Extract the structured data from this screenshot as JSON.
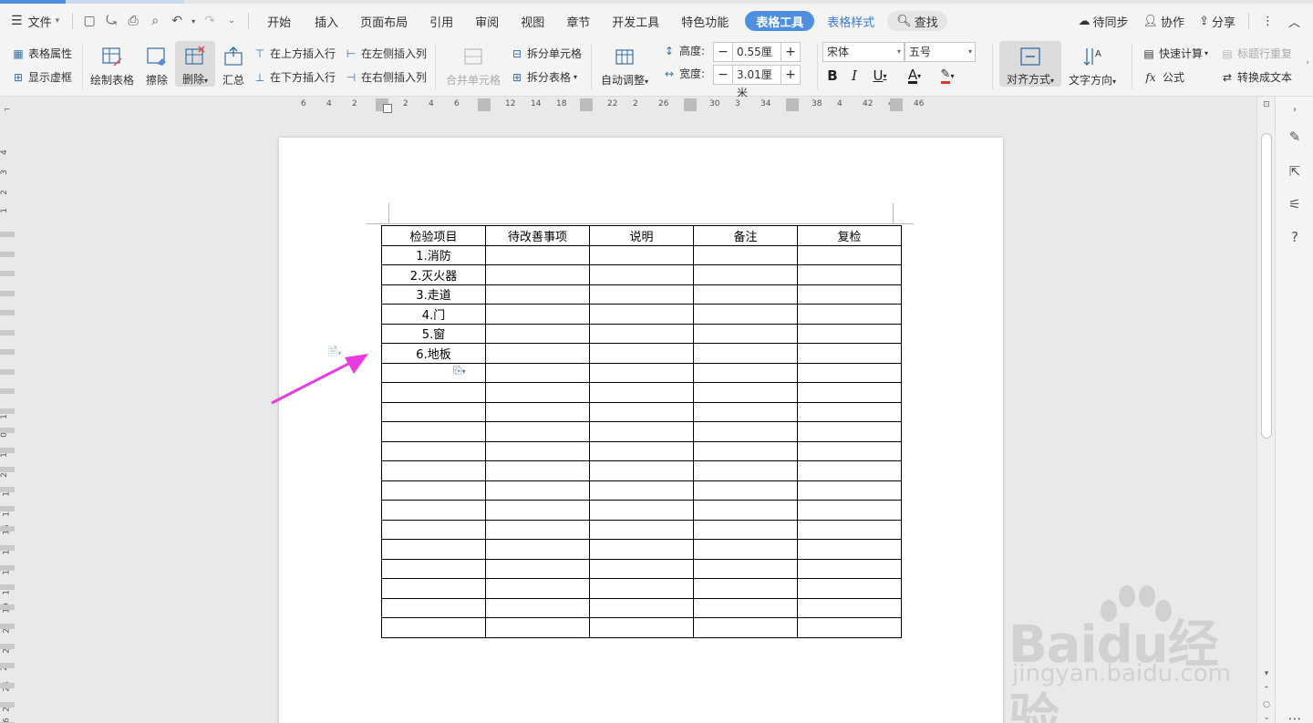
{
  "menubar": {
    "file": "文件",
    "tabs": [
      "开始",
      "插入",
      "页面布局",
      "引用",
      "审阅",
      "视图",
      "章节",
      "开发工具",
      "特色功能"
    ],
    "active_tab": "表格工具",
    "table_style_tab": "表格样式",
    "search": "查找",
    "sync": "待同步",
    "collab": "协作",
    "share": "分享"
  },
  "ribbon": {
    "table_props": "表格属性",
    "show_gridlines": "显示虚框",
    "draw_table": "绘制表格",
    "erase": "擦除",
    "delete": "删除",
    "summary": "汇总",
    "insert_row_above": "在上方插入行",
    "insert_row_below": "在下方插入行",
    "insert_col_left": "在左侧插入列",
    "insert_col_right": "在右侧插入列",
    "merge_cells": "合并单元格",
    "split_cells": "拆分单元格",
    "split_table": "拆分表格",
    "auto_fit": "自动调整",
    "height_label": "高度:",
    "height_value": "0.55厘米",
    "width_label": "宽度:",
    "width_value": "3.01厘米",
    "font_name": "宋体",
    "font_size": "五号",
    "align": "对齐方式",
    "text_dir": "文字方向",
    "quick_calc": "快速计算",
    "repeat_header": "标题行重复",
    "formula": "公式",
    "to_text": "转换成文本"
  },
  "hruler_numbers": [
    "6",
    "4",
    "2",
    "2",
    "4",
    "6",
    "10",
    "12",
    "14",
    "18",
    "20",
    "22",
    "2",
    "26",
    "28",
    "30",
    "3",
    "34",
    "36",
    "38",
    "4",
    "42",
    "44",
    "46"
  ],
  "vruler_numbers": [
    "4",
    "3",
    "2",
    "1",
    "1",
    "0",
    "1",
    "2",
    "13",
    "14",
    "15",
    "16",
    "17",
    "18",
    "19",
    "20",
    "21",
    "2",
    "24",
    "25",
    "26"
  ],
  "table": {
    "header": [
      "检验项目",
      "待改善事项",
      "说明",
      "备注",
      "复检"
    ],
    "first_col": [
      "1.消防",
      "2.灭火器",
      "3.走道",
      "4.门",
      "5.窗",
      "6.地板"
    ],
    "total_rows": 21,
    "cols": 5
  },
  "watermark": {
    "logo": "Baidu经验",
    "site": "jingyan.baidu.com"
  },
  "colors": {
    "accent": "#4e8fe0",
    "arrow": "#e83ce0"
  }
}
